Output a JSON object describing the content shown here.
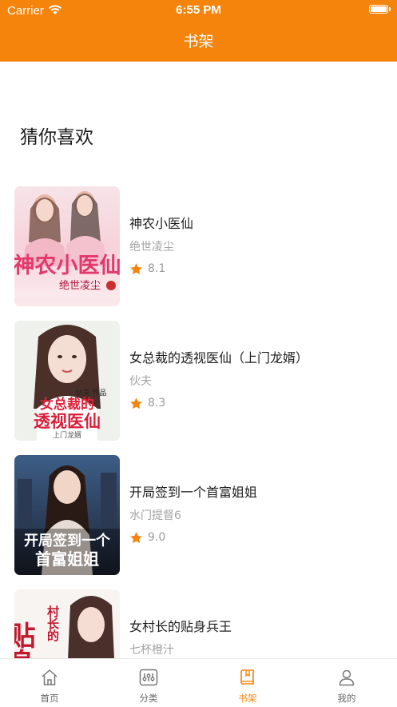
{
  "status_bar": {
    "carrier": "Carrier",
    "time": "6:55 PM"
  },
  "nav": {
    "title": "书架"
  },
  "section": {
    "title": "猜你喜欢"
  },
  "books": [
    {
      "title": "神农小医仙",
      "author": "绝世凌尘",
      "rating": "8.1",
      "cover_text": "神农小医仙",
      "cover_sub": "绝世凌尘"
    },
    {
      "title": "女总裁的透视医仙（上门龙婿）",
      "author": "伙夫",
      "rating": "8.3",
      "cover_text1": "女总裁的",
      "cover_text2": "透视医仙",
      "cover_sub": "上门龙婿",
      "cover_author": "伙夫 作品"
    },
    {
      "title": "开局签到一个首富姐姐",
      "author": "水门提督6",
      "rating": "9.0",
      "cover_text1": "开局签到一个",
      "cover_text2": "首富姐姐"
    },
    {
      "title": "女村长的贴身兵王",
      "author": "七杯橙汁",
      "rating": "",
      "cover_text1": "贴身",
      "cover_text2": "村长的"
    }
  ],
  "tabbar": {
    "tabs": [
      {
        "label": "首页",
        "icon": "home-icon",
        "active": false
      },
      {
        "label": "分类",
        "icon": "category-icon",
        "active": false
      },
      {
        "label": "书架",
        "icon": "bookshelf-icon",
        "active": true
      },
      {
        "label": "我的",
        "icon": "profile-icon",
        "active": false
      }
    ]
  },
  "colors": {
    "accent": "#f5840d",
    "star": "#f5840d",
    "muted": "#a3a3a3"
  }
}
